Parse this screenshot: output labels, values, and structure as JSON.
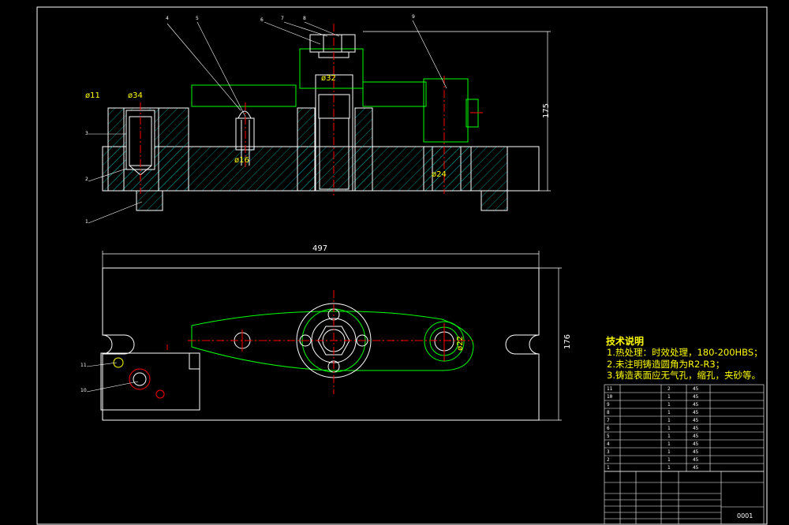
{
  "tech_notes": {
    "title": "技术说明",
    "lines": [
      "1.热处理：时效处理，180-200HBS；",
      "2.未注明铸造圆角为R2-R3；",
      "3.铸造表面应无气孔，缩孔，夹砂等。"
    ]
  },
  "dimensions": {
    "length": "497",
    "width": "176",
    "height": "175",
    "hole_d11": "ø11",
    "hole_d34": "ø34",
    "hole_d16": "ø16",
    "hole_d32": "ø32",
    "hole_d24": "ø24",
    "hole_d22": "ø22"
  },
  "balloons": [
    "1",
    "2",
    "3",
    "4",
    "5",
    "6",
    "7",
    "8",
    "9",
    "10",
    "11"
  ],
  "bom": {
    "rows": [
      {
        "no": "11",
        "qty": "2",
        "mat": "45"
      },
      {
        "no": "10",
        "qty": "1",
        "mat": "45"
      },
      {
        "no": "9",
        "qty": "1",
        "mat": "45"
      },
      {
        "no": "8",
        "qty": "1",
        "mat": "45"
      },
      {
        "no": "7",
        "qty": "1",
        "mat": "45"
      },
      {
        "no": "6",
        "qty": "1",
        "mat": "45"
      },
      {
        "no": "5",
        "qty": "1",
        "mat": "45"
      },
      {
        "no": "4",
        "qty": "1",
        "mat": "45"
      },
      {
        "no": "3",
        "qty": "1",
        "mat": "45"
      },
      {
        "no": "2",
        "qty": "1",
        "mat": "45"
      },
      {
        "no": "1",
        "qty": "1",
        "mat": "45"
      }
    ]
  },
  "title_block": {
    "drawing_code": "0001"
  },
  "colors": {
    "background": "#000000",
    "outline": "#ffffff",
    "arm": "#00ff00",
    "centerline": "#ff0000",
    "text": "#ffff00",
    "hatch": "#00ffff"
  }
}
